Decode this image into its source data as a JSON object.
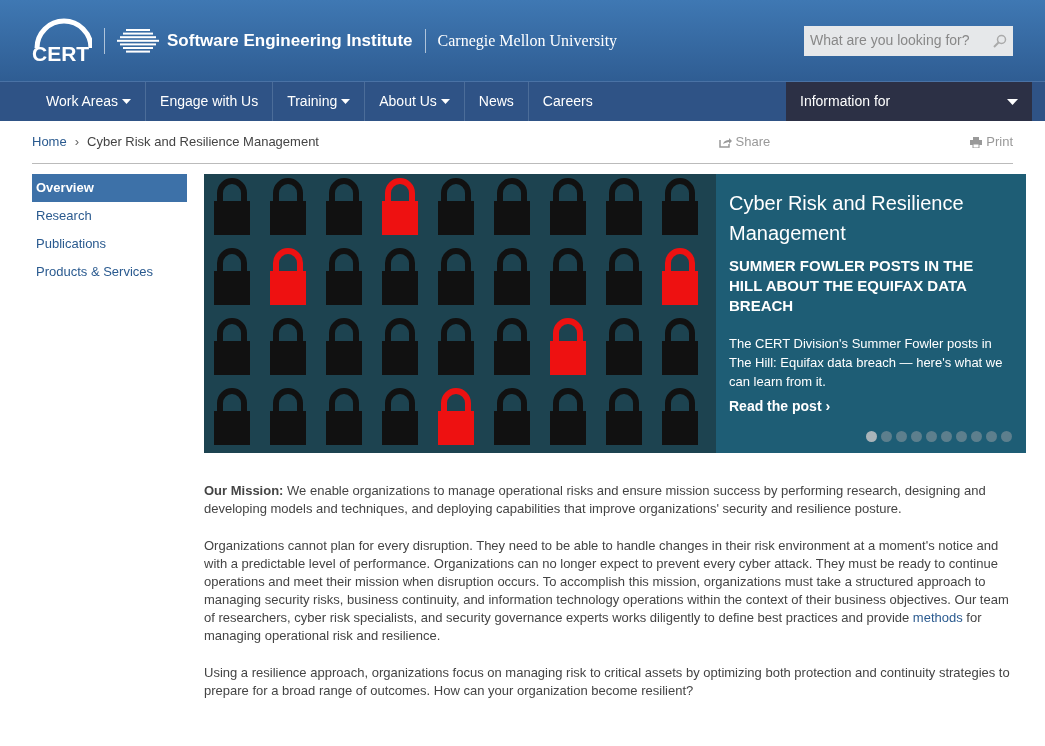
{
  "header": {
    "logo_text": "CERT",
    "institute": "Software Engineering Institute",
    "university": "Carnegie Mellon University",
    "search": {
      "placeholder": "What are you looking for?"
    }
  },
  "nav": {
    "items": [
      {
        "label": "Work Areas",
        "dropdown": true
      },
      {
        "label": "Engage with Us",
        "dropdown": false
      },
      {
        "label": "Training",
        "dropdown": true
      },
      {
        "label": "About Us",
        "dropdown": true
      },
      {
        "label": "News",
        "dropdown": false
      },
      {
        "label": "Careers",
        "dropdown": false
      }
    ],
    "info_for": "Information for"
  },
  "breadcrumb": {
    "home": "Home",
    "separator": "›",
    "current": "Cyber Risk and Resilience Management"
  },
  "actions": {
    "share": "Share",
    "print": "Print"
  },
  "sidebar": {
    "items": [
      {
        "label": "Overview",
        "selected": true
      },
      {
        "label": "Research",
        "selected": false
      },
      {
        "label": "Publications",
        "selected": false
      },
      {
        "label": "Products & Services",
        "selected": false
      }
    ]
  },
  "hero": {
    "title": "Cyber Risk and Resilience Management",
    "headline": "SUMMER FOWLER POSTS IN THE HILL ABOUT THE EQUIFAX DATA BREACH",
    "summary": "The CERT Division's Summer Fowler posts in The Hill: Equifax data breach — here's what we can learn from it.",
    "link": "Read the post",
    "link_arrow": "›",
    "dots": [
      {
        "selected": true
      },
      {
        "selected": false
      },
      {
        "selected": false
      },
      {
        "selected": false
      },
      {
        "selected": false
      },
      {
        "selected": false
      },
      {
        "selected": false
      },
      {
        "selected": false
      },
      {
        "selected": false
      },
      {
        "selected": false
      }
    ]
  },
  "paragraphs": [
    {
      "text": "**Our Mission:** We enable organizations to manage operational risks and ensure mission success by performing research, designing and developing models and techniques, and deploying capabilities that improve organizations' security and resilience posture."
    },
    {
      "text": "Organizations cannot plan for every disruption. They need to be able to handle changes in their risk environment at a moment's notice and with a predictable level of performance. Organizations can no longer expect to prevent every cyber attack. They must be ready to continue operations and meet their mission when disruption occurs. To accomplish this mission, organizations must take a structured approach to managing security risks, business continuity, and information technology operations within the context of their business objectives. Our team of researchers, cyber risk specialists, and security governance experts works diligently to define best practices and provide",
      "link": "methods",
      "text_after": "for managing operational risk and resilience."
    },
    {
      "text": "Using a resilience approach, organizations focus on managing risk to critical assets by optimizing both protection and continuity strategies to prepare for a broad range of outcomes. How can your organization become resilient?"
    }
  ]
}
